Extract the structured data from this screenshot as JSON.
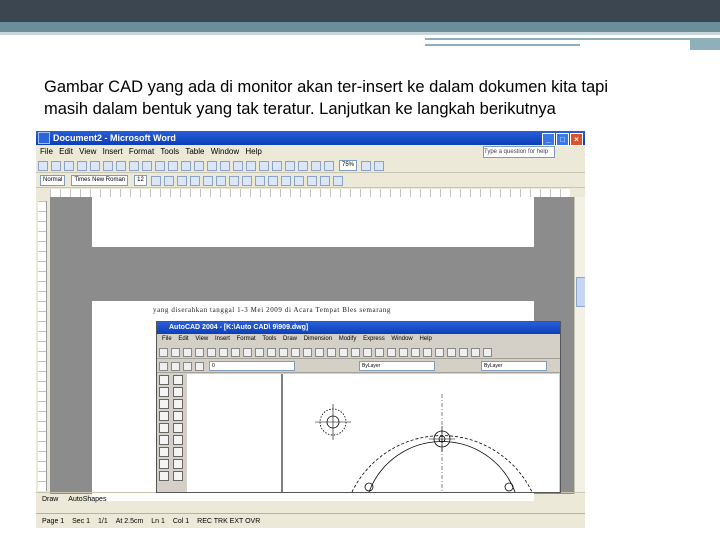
{
  "slide": {
    "caption_line1": "Gambar CAD yang ada di monitor akan ter-insert ke dalam dokumen kita tapi",
    "caption_line2": "masih dalam bentuk yang tak teratur. Lanjutkan ke langkah berikutnya"
  },
  "word": {
    "title": "Document2 - Microsoft Word",
    "menu": [
      "File",
      "Edit",
      "View",
      "Insert",
      "Format",
      "Tools",
      "Table",
      "Window",
      "Help"
    ],
    "help_placeholder": "Type a question for help",
    "zoom": "75%",
    "style": "Normal",
    "font": "Times New Roman",
    "font_size": "12",
    "document_text": "yang diserahkan tanggal 1-3 Mei 2009 di Acara Tempat Bles semarang",
    "status": {
      "page": "Page 1",
      "section": "Sec 1",
      "page_of": "1/1",
      "at": "At 2.5cm",
      "ln": "Ln 1",
      "col": "Col 1",
      "modes": "REC TRK EXT OVR"
    },
    "drawbar": {
      "draw_label": "Draw",
      "autoshapes_label": "AutoShapes"
    }
  },
  "acad": {
    "title": "AutoCAD 2004 - [K:\\Auto CAD\\ 9\\909.dwg]",
    "menu": [
      "File",
      "Edit",
      "View",
      "Insert",
      "Format",
      "Tools",
      "Draw",
      "Dimension",
      "Modify",
      "Express",
      "Window",
      "Help"
    ],
    "layer": "0",
    "bylayer_1": "ByLayer",
    "bylayer_2": "ByLayer"
  },
  "colors": {
    "title_bar": "#0a3fb8",
    "slide_bar_dark": "#3c4650",
    "slide_bar_accent": "#6b8f9a"
  }
}
